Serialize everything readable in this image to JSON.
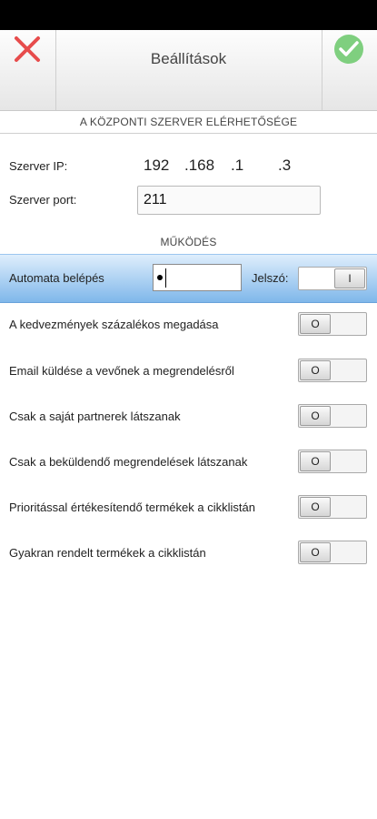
{
  "header": {
    "title": "Beállítások"
  },
  "sections": {
    "server": "A KÖZPONTI SZERVER ELÉRHETŐSÉGE",
    "operation": "MŰKÖDÉS"
  },
  "server": {
    "ip_label": "Szerver IP:",
    "ip_segments": [
      "192",
      ".168",
      ".1",
      ".3"
    ],
    "port_label": "Szerver port:",
    "port_value": "211"
  },
  "auto_login": {
    "label": "Automata belépés",
    "password_label": "Jelszó:",
    "password_toggle": "I"
  },
  "settings": [
    {
      "label": "A kedvezmények százalékos megadása",
      "state": "O"
    },
    {
      "label": "Email küldése a vevőnek a megrendelésről",
      "state": "O"
    },
    {
      "label": "Csak a saját partnerek látszanak",
      "state": "O"
    },
    {
      "label": "Csak a beküldendő megrendelések látszanak",
      "state": "O"
    },
    {
      "label": "Prioritással értékesítendő termékek a cikklistán",
      "state": "O"
    },
    {
      "label": "Gyakran rendelt termékek a cikklistán",
      "state": "O"
    }
  ],
  "colors": {
    "cancel": "#e74c4c",
    "confirm": "#7fcf7f",
    "highlight": "#7fb7ea"
  },
  "icons": {
    "cancel": "close-icon",
    "confirm": "check-icon"
  }
}
